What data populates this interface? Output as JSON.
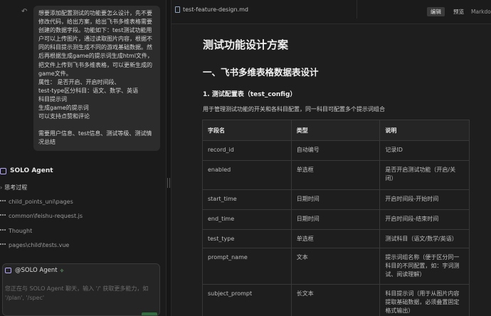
{
  "chat": {
    "user_message": "想要添加配置测试的功能要怎么设计，先不要修改代码，给出方案，给出飞书多维表格需要创建的数据字段。功能如下：test测试功能用户可以上传图片，通过读取图片内容，根据不同的科目提示测生成不同的游戏基础数据。然后再根据生成game的提示词生成html文件，把文件上传到飞书多维表格，可以更新生成的game文件。\n属性： 是否开启、开启时间段、\ntest-type区分科目：语文、数学、英语\n科目提示词\n生成game的提示词\n可以支持点赞和评论\n\n需要用户信息、test信息、测试等级、测试情况总结",
    "agent_name": "SOLO Agent",
    "thinking_label": "思考过程",
    "steps": [
      "child_points_uni\\pages",
      "common\\feishu-request.js",
      "Thought",
      "pages\\child\\tests.vue"
    ],
    "input_mention": "@SOLO Agent",
    "input_placeholder": "您正在与 SOLO Agent 聊天，输入 '/' 获取更多能力，如 '/plan', '/spec'"
  },
  "editor": {
    "file_name": "test-feature-design.md",
    "edit_label": "编辑",
    "preview_label": "预览",
    "mode_label": "Markdow"
  },
  "doc": {
    "h1": "测试功能设计方案",
    "h2": "一、飞书多维表格数据表设计",
    "h3": "1. 测试配置表（test_config）",
    "para": "用于管理测试功能的开关和各科目配置，同一科目可配置多个提示词组合",
    "table_headers": [
      "字段名",
      "类型",
      "说明"
    ],
    "rows": [
      [
        "record_id",
        "自动编号",
        "记录ID"
      ],
      [
        "enabled",
        "单选框",
        "是否开启测试功能（开启/关闭）"
      ],
      [
        "start_time",
        "日期时间",
        "开启时间段-开始时间"
      ],
      [
        "end_time",
        "日期时间",
        "开启时间段-结束时间"
      ],
      [
        "test_type",
        "单选框",
        "测试科目（语文/数学/英语）"
      ],
      [
        "prompt_name",
        "文本",
        "提示词组名称（便于区分同一科目的不同配置，如：字词测试、阅读理解）"
      ],
      [
        "subject_prompt",
        "长文本",
        "科目提示词（用于从图片内容提取基础数据，必须叠置固定格式输出）"
      ]
    ]
  },
  "colors": {
    "accent": "#b8a9ff",
    "background": "#1e1e1e",
    "panel": "#1b1b1b"
  }
}
